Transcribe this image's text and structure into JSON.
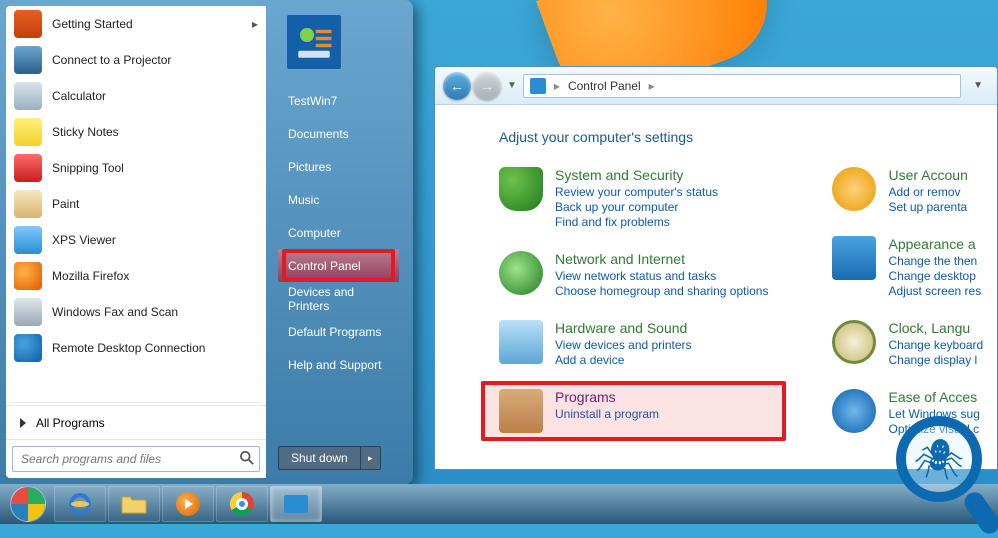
{
  "start_menu": {
    "programs": [
      {
        "label": "Getting Started",
        "icon": "pi-getstarted",
        "submenu": true
      },
      {
        "label": "Connect to a Projector",
        "icon": "pi-projector"
      },
      {
        "label": "Calculator",
        "icon": "pi-calc"
      },
      {
        "label": "Sticky Notes",
        "icon": "pi-sticky"
      },
      {
        "label": "Snipping Tool",
        "icon": "pi-snip"
      },
      {
        "label": "Paint",
        "icon": "pi-paint"
      },
      {
        "label": "XPS Viewer",
        "icon": "pi-xps"
      },
      {
        "label": "Mozilla Firefox",
        "icon": "pi-firefox"
      },
      {
        "label": "Windows Fax and Scan",
        "icon": "pi-fax"
      },
      {
        "label": "Remote Desktop Connection",
        "icon": "pi-rdc"
      }
    ],
    "all_programs": "All Programs",
    "search_placeholder": "Search programs and files",
    "right": {
      "user": "TestWin7",
      "items": [
        "Documents",
        "Pictures",
        "Music",
        "Computer",
        "Control Panel",
        "Devices and Printers",
        "Default Programs",
        "Help and Support"
      ],
      "selected_index": 4
    },
    "shutdown": "Shut down"
  },
  "control_panel": {
    "breadcrumb": [
      "Control Panel"
    ],
    "heading": "Adjust your computer's settings",
    "left_col": [
      {
        "title": "System and Security",
        "icon": "ic-shield",
        "links": [
          "Review your computer's status",
          "Back up your computer",
          "Find and fix problems"
        ]
      },
      {
        "title": "Network and Internet",
        "icon": "ic-net",
        "links": [
          "View network status and tasks",
          "Choose homegroup and sharing options"
        ]
      },
      {
        "title": "Hardware and Sound",
        "icon": "ic-hw",
        "links": [
          "View devices and printers",
          "Add a device"
        ]
      },
      {
        "title": "Programs",
        "icon": "ic-prog",
        "hl": true,
        "links": [
          "Uninstall a program"
        ]
      }
    ],
    "right_col": [
      {
        "title": "User Accoun",
        "icon": "ic-user",
        "links": [
          "Add or remov",
          "Set up parenta"
        ]
      },
      {
        "title": "Appearance a",
        "icon": "ic-app",
        "links": [
          "Change the then",
          "Change desktop",
          "Adjust screen res"
        ]
      },
      {
        "title": "Clock, Langu",
        "icon": "ic-clock",
        "links": [
          "Change keyboard",
          "Change display l"
        ]
      },
      {
        "title": "Ease of Acces",
        "icon": "ic-ease",
        "links": [
          "Let Windows sug",
          "Optimize visual c"
        ]
      }
    ]
  },
  "taskbar": {
    "items": [
      {
        "name": "start-orb"
      },
      {
        "name": "internet-explorer-icon"
      },
      {
        "name": "file-explorer-icon"
      },
      {
        "name": "windows-media-player-icon"
      },
      {
        "name": "google-chrome-icon"
      },
      {
        "name": "control-panel-taskbar-icon",
        "active": true
      }
    ]
  }
}
